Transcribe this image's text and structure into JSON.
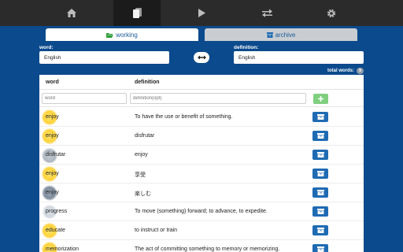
{
  "nav": {
    "items": [
      {
        "icon": "home-icon"
      },
      {
        "icon": "cards-icon",
        "active": true
      },
      {
        "icon": "play-icon"
      },
      {
        "icon": "swap-arrows-icon"
      },
      {
        "icon": "gear-icon"
      }
    ]
  },
  "tabs": {
    "working": "working",
    "archive": "archive"
  },
  "languages": {
    "word_label": "word:",
    "word_value": "English",
    "definition_label": "definition:",
    "definition_value": "English"
  },
  "total": {
    "label": "total words:",
    "count": "9"
  },
  "table": {
    "headers": {
      "word": "word",
      "definition": "definition"
    },
    "new_word_placeholder": "word",
    "new_definition_placeholder": "definition(opt)",
    "rows": [
      {
        "word": "enjoy",
        "definition": "To have the use or benefit of something.",
        "weather": "sun"
      },
      {
        "word": "enjoy",
        "definition": "disfrutar",
        "weather": "sun"
      },
      {
        "word": "disfrutar",
        "definition": "enjoy",
        "weather": "cloud"
      },
      {
        "word": "enjoy",
        "definition": "享受",
        "weather": "sun"
      },
      {
        "word": "enjoy",
        "definition": "楽しむ",
        "weather": "storm"
      },
      {
        "word": "progress",
        "definition": "To move (something) forward; to advance, to expedite.",
        "weather": "plain"
      },
      {
        "word": "educate",
        "definition": "to instruct or train",
        "weather": "sun"
      },
      {
        "word": "memorization",
        "definition": "The act of committing something to memory or memorizing.",
        "weather": "sun"
      }
    ]
  },
  "colors": {
    "background": "#0b4a8c",
    "topbar": "#2b2b2b",
    "accent": "#1f6bb3",
    "add_button": "#7fcf7f"
  }
}
